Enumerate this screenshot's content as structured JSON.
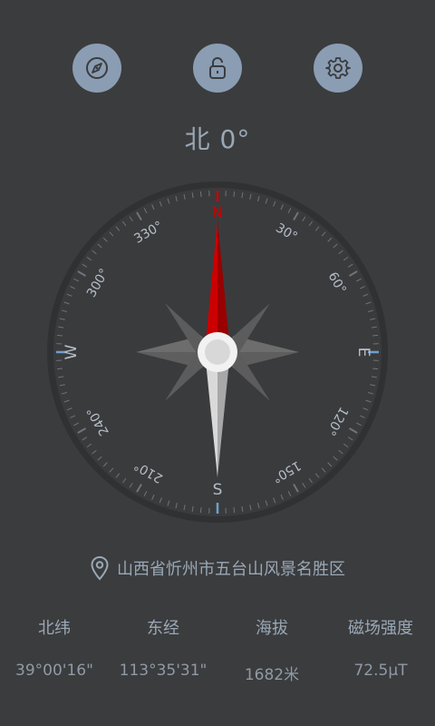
{
  "header": {
    "buttons": [
      {
        "icon": "compass-icon"
      },
      {
        "icon": "unlock-icon"
      },
      {
        "icon": "gear-icon"
      }
    ],
    "accent_color": "#8a9db3"
  },
  "heading": {
    "direction": "北",
    "angle": "0°"
  },
  "dial": {
    "cardinals": {
      "N": "N",
      "E": "E",
      "S": "S",
      "W": "W"
    },
    "degree_labels": [
      "30°",
      "60°",
      "120°",
      "150°",
      "210°",
      "240°",
      "300°",
      "330°"
    ],
    "needle_north_color": "#cc0000",
    "needle_south_color": "#d0d0d0"
  },
  "location": {
    "text": "山西省忻州市五台山风景名胜区",
    "icon": "location-pin-icon"
  },
  "info": {
    "labels": [
      "北纬",
      "东经",
      "海拔",
      "磁场强度"
    ],
    "values": [
      "39°00'16\"",
      "113°35'31\"",
      "1682米",
      "72.5μT"
    ]
  }
}
